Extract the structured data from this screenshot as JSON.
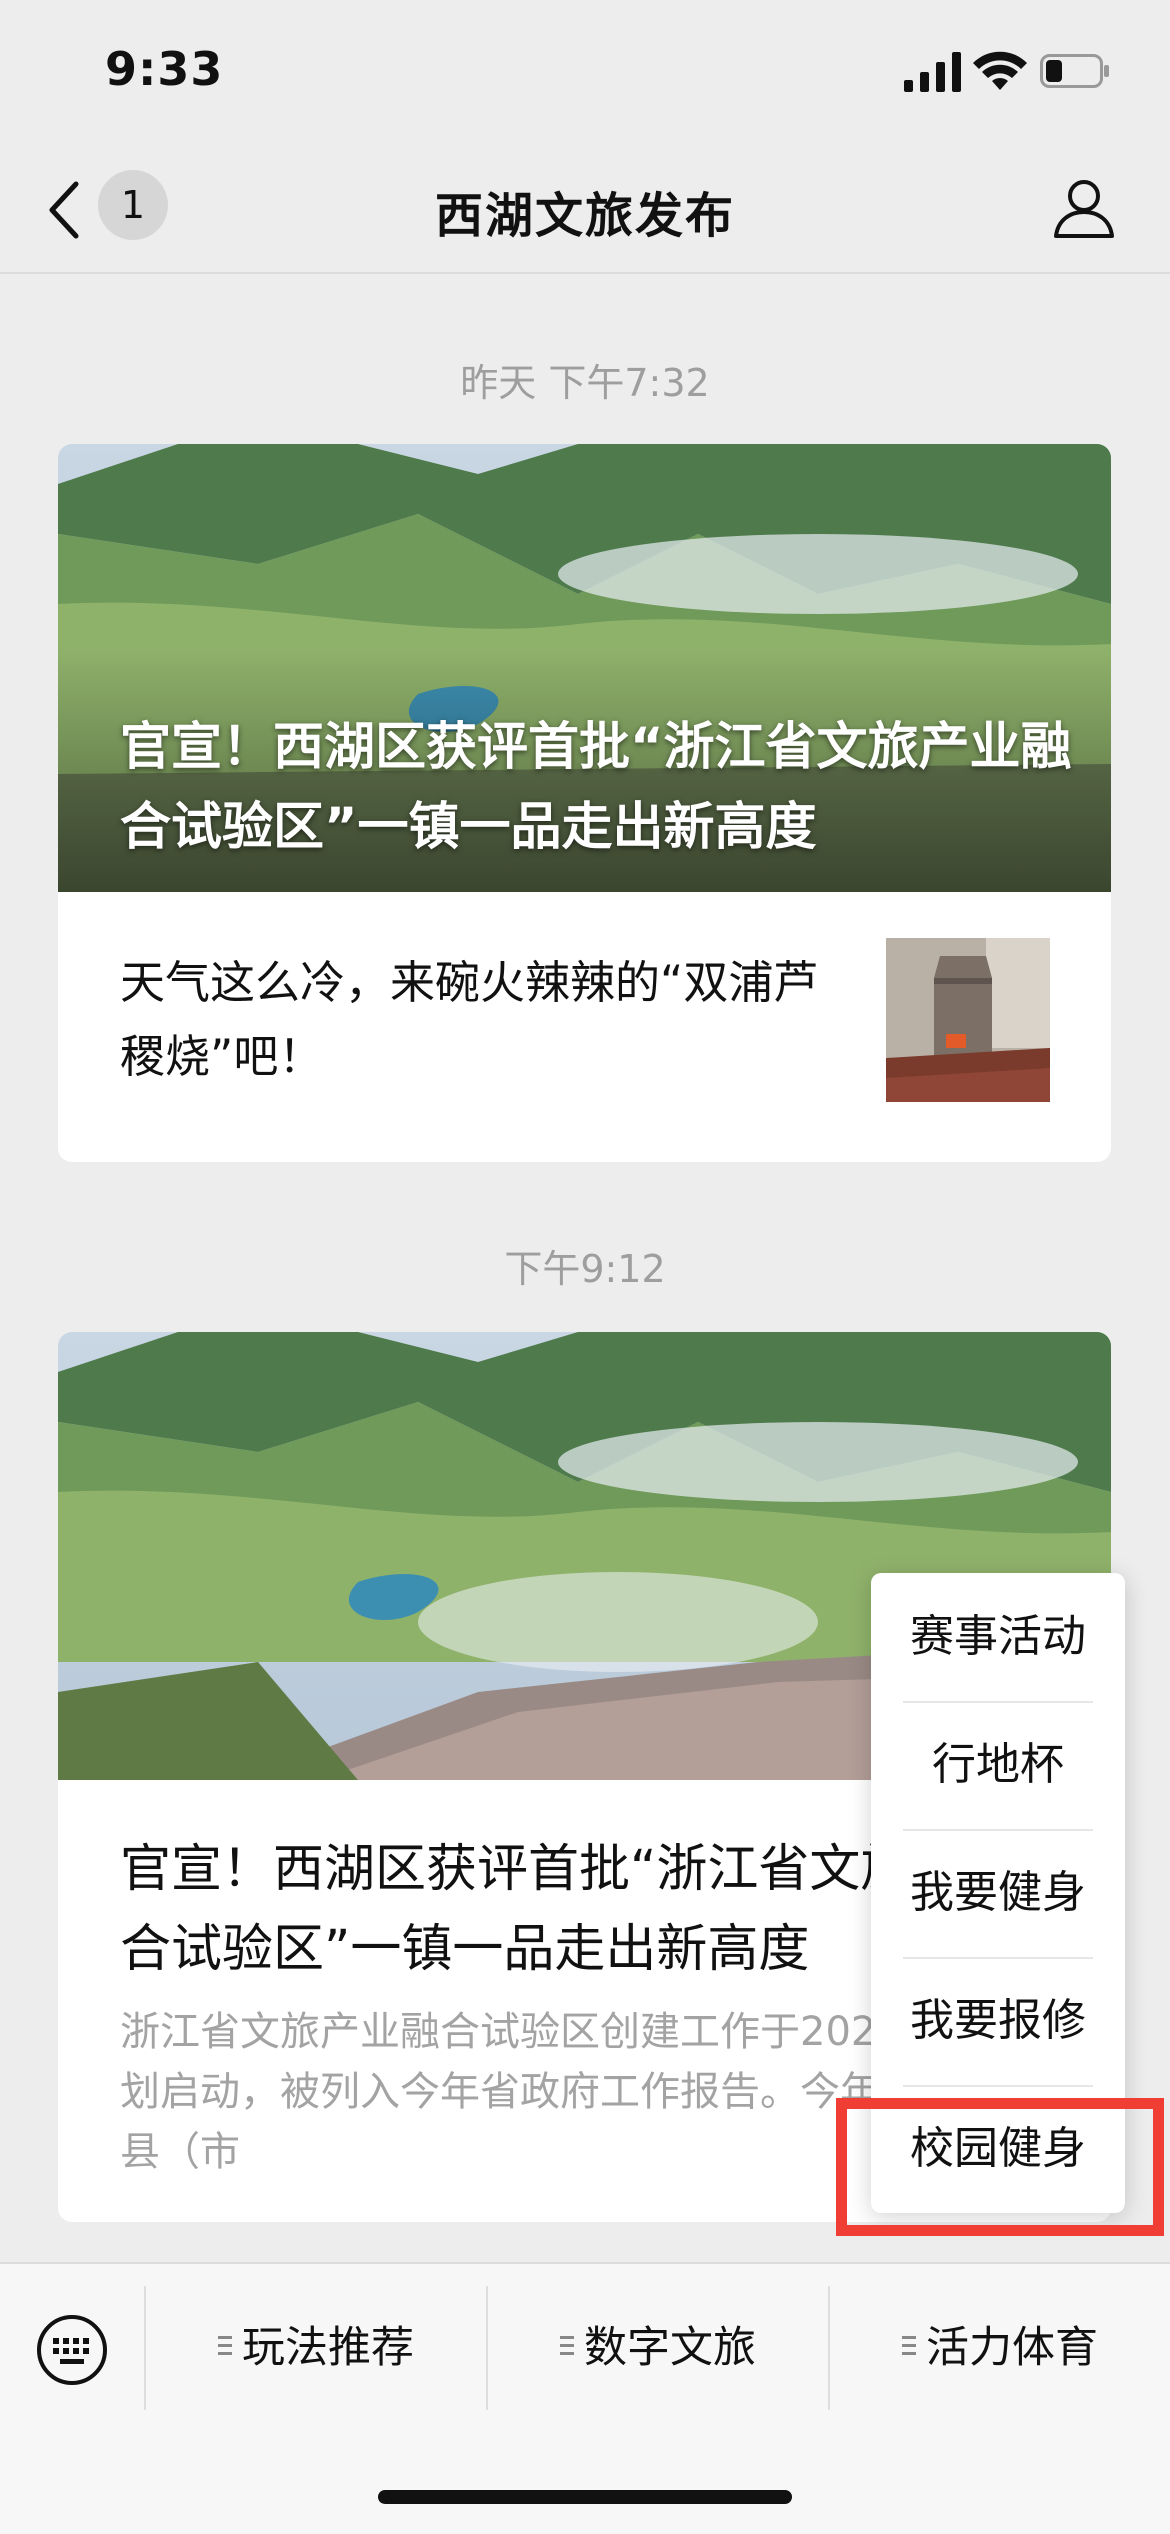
{
  "status_bar": {
    "time": "9:33"
  },
  "nav": {
    "unread_count": "1",
    "title": "西湖文旅发布"
  },
  "messages": [
    {
      "timestamp": "昨天 下午7:32",
      "cover_title": "官宣！西湖区获评首批“浙江省文旅产业融合试验区”一镇一品走出新高度",
      "sub_item": {
        "title": "天气这么冷，来碗火辣辣的“双浦芦稷烧”吧！"
      }
    },
    {
      "timestamp": "下午9:12",
      "title": "官宣！西湖区获评首批“浙江省文旅产业融合试验区”一镇一品走出新高度",
      "digest": "浙江省文旅产业融合试验区创建工作于2020年下半年谋划启动，被列入今年省政府工作报告。今年年初，26个县（市"
    }
  ],
  "popup_menu": {
    "items": [
      "赛事活动",
      "行地杯",
      "我要健身",
      "我要报修",
      "校园健身"
    ],
    "highlighted_item": "校园健身",
    "highlight_color": "#f03e35"
  },
  "bottom_menu": {
    "items": [
      {
        "label": "玩法推荐"
      },
      {
        "label": "数字文旅"
      },
      {
        "label": "活力体育"
      }
    ]
  }
}
